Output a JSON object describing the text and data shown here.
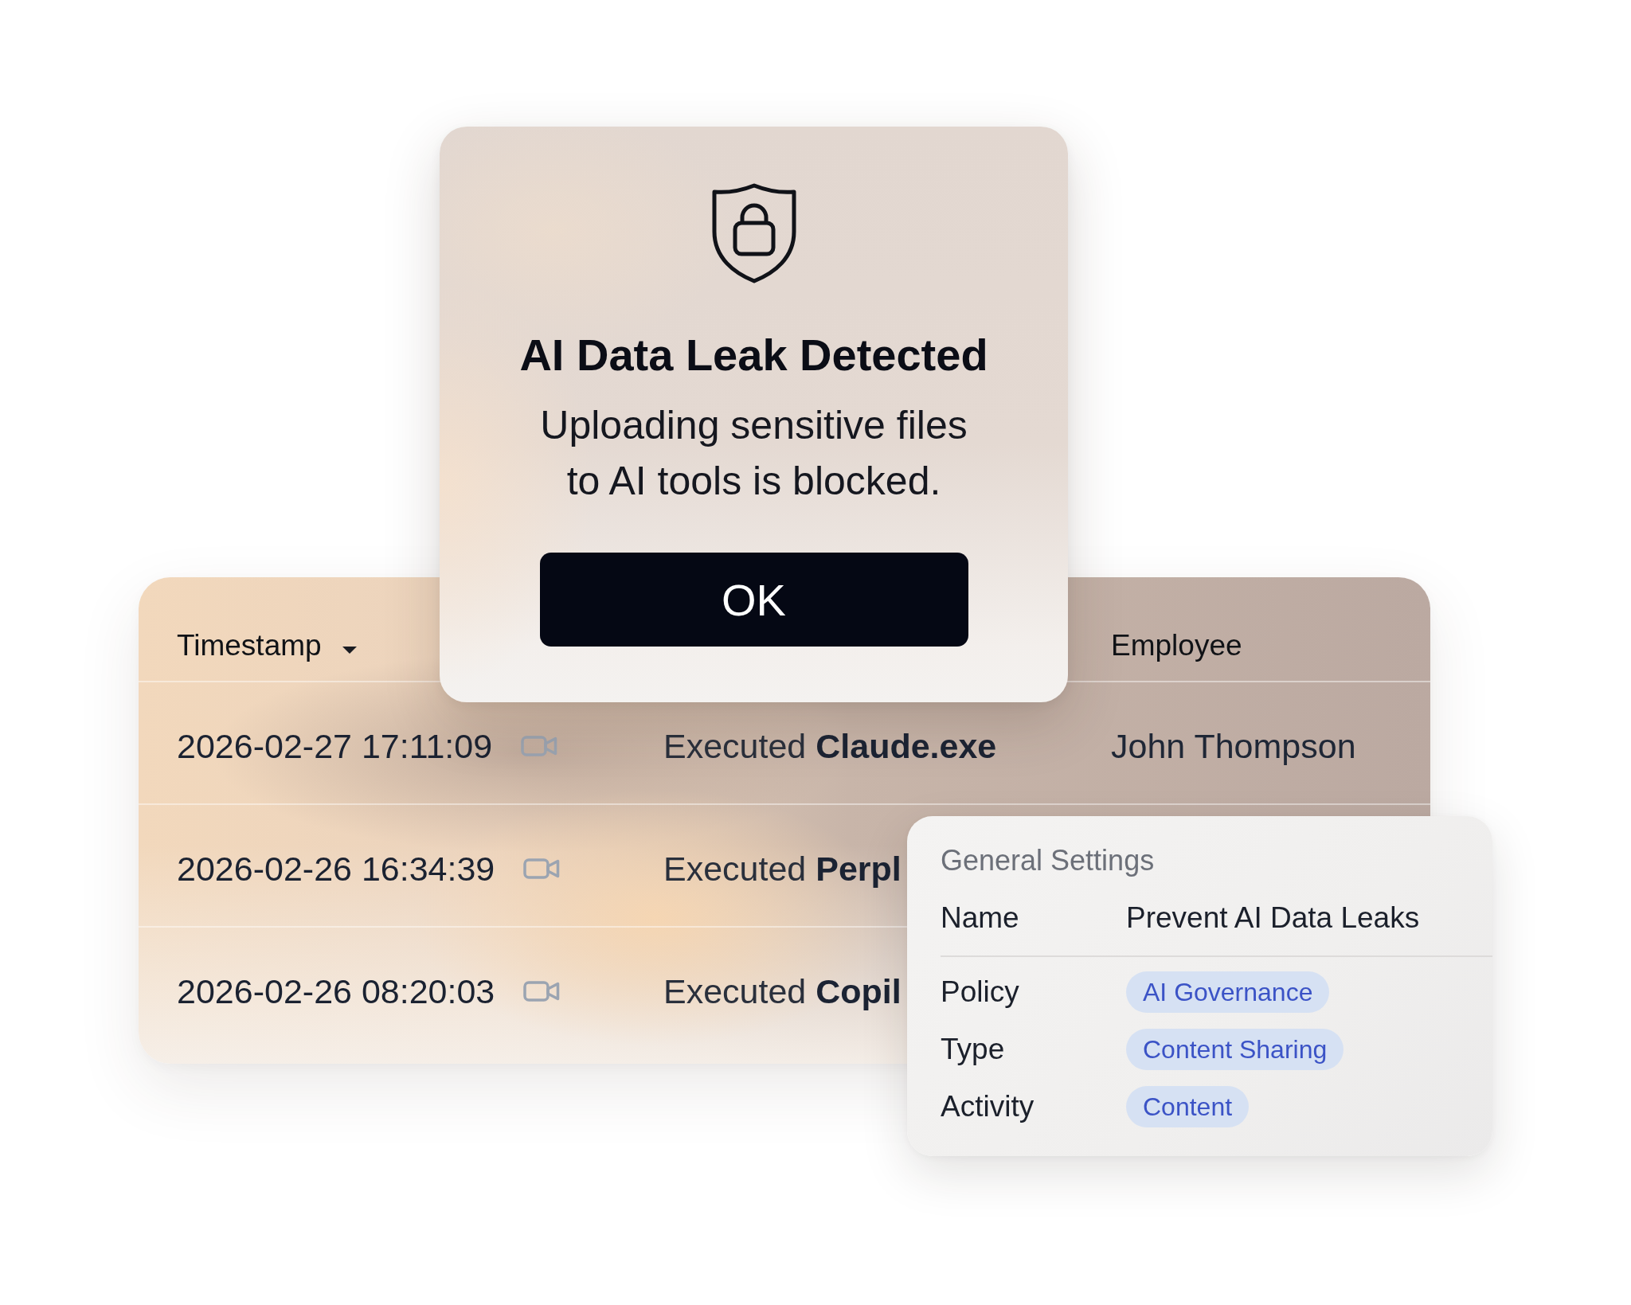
{
  "alert_dialog": {
    "title": "AI Data Leak Detected",
    "message": "Uploading sensitive files\nto AI tools is blocked.",
    "button": "OK"
  },
  "table": {
    "header": {
      "timestamp": {
        "label": "Timestamp",
        "sorted": true
      },
      "employee": {
        "label": "Employee",
        "sorted": false
      }
    },
    "rows": [
      {
        "timestamp": "2026-02-27 17:11:09",
        "has_recording": true,
        "event": "Executed **Claude.exe**",
        "employee": "John Thompson"
      },
      {
        "timestamp": "2026-02-26 16:34:39",
        "has_recording": true,
        "event": "Executed **Perpl**"
      },
      {
        "timestamp": "2026-02-26 08:20:03",
        "has_recording": true,
        "event": "Executed **Copil**"
      }
    ]
  },
  "settings_panel": {
    "title": "General Settings",
    "name": {
      "label": "Name",
      "value": "Prevent AI Data Leaks"
    },
    "tags": [
      {
        "label": "Policy",
        "value": "AI Governance"
      },
      {
        "label": "Type",
        "value": "Content Sharing"
      },
      {
        "label": "Activity",
        "value": "Content"
      }
    ]
  }
}
